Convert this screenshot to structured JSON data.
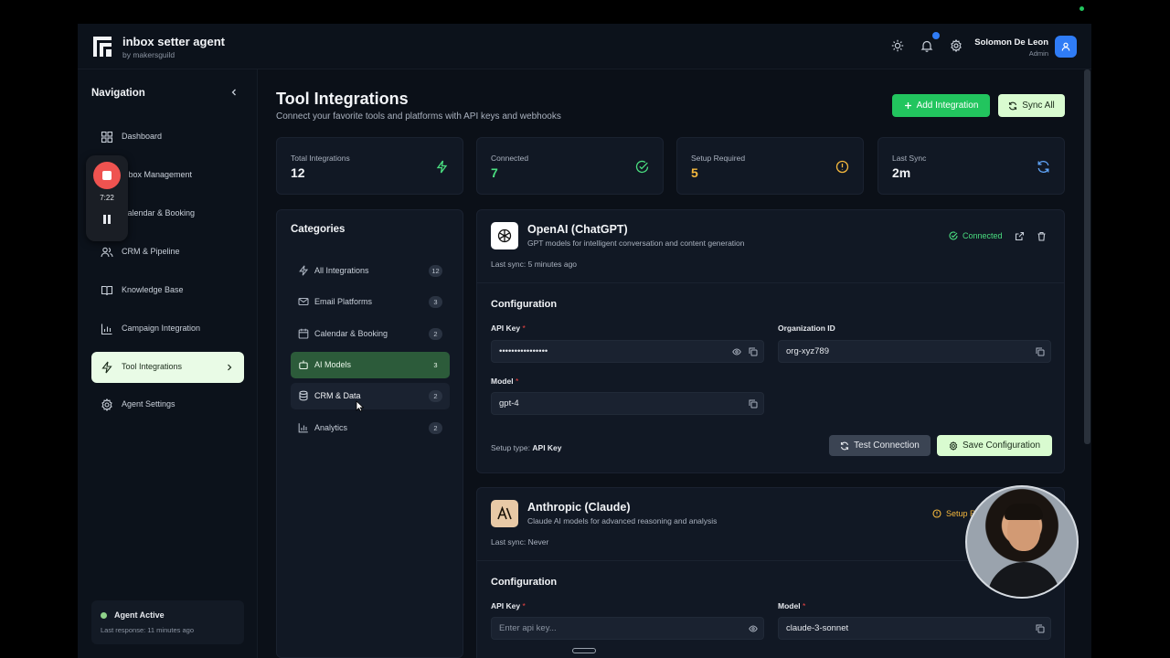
{
  "brand": {
    "title": "inbox setter agent",
    "subtitle": "by makersguild"
  },
  "header": {
    "user_name": "Solomon De Leon",
    "user_role": "Admin",
    "icons": [
      "sun-icon",
      "bell-icon",
      "gear-icon",
      "user-icon"
    ]
  },
  "recorder": {
    "time": "7:22"
  },
  "sidebar": {
    "title": "Navigation",
    "items": [
      {
        "label": "Dashboard",
        "icon": "grid-icon"
      },
      {
        "label": "Inbox Management",
        "icon": "inbox-icon"
      },
      {
        "label": "Calendar & Booking",
        "icon": "calendar-icon"
      },
      {
        "label": "CRM & Pipeline",
        "icon": "users-icon"
      },
      {
        "label": "Knowledge Base",
        "icon": "book-icon"
      },
      {
        "label": "Campaign Integration",
        "icon": "chart-icon"
      },
      {
        "label": "Tool Integrations",
        "icon": "bolt-icon",
        "active": true
      },
      {
        "label": "Agent Settings",
        "icon": "gear-icon"
      }
    ],
    "status": {
      "title": "Agent Active",
      "subtitle": "Last response: 11 minutes ago"
    }
  },
  "page": {
    "title": "Tool Integrations",
    "subtitle": "Connect your favorite tools and platforms with API keys and webhooks",
    "add_label": "Add Integration",
    "sync_label": "Sync All"
  },
  "stats": [
    {
      "label": "Total Integrations",
      "value": "12",
      "color": "#f2f4f7",
      "icon": "bolt-icon"
    },
    {
      "label": "Connected",
      "value": "7",
      "color": "#4ade80",
      "icon": "check-circle-icon"
    },
    {
      "label": "Setup Required",
      "value": "5",
      "color": "#f5b83d",
      "icon": "alert-circle-icon"
    },
    {
      "label": "Last Sync",
      "value": "2m",
      "color": "#f2f4f7",
      "icon": "refresh-icon"
    }
  ],
  "categories": {
    "title": "Categories",
    "items": [
      {
        "label": "All Integrations",
        "count": "12"
      },
      {
        "label": "Email Platforms",
        "count": "3"
      },
      {
        "label": "Calendar & Booking",
        "count": "2"
      },
      {
        "label": "AI Models",
        "count": "3",
        "active": true
      },
      {
        "label": "CRM & Data",
        "count": "2"
      },
      {
        "label": "Analytics",
        "count": "2"
      }
    ]
  },
  "integrations": [
    {
      "name": "OpenAI (ChatGPT)",
      "description": "GPT models for intelligent conversation and content generation",
      "last_sync": "Last sync: 5 minutes ago",
      "status": "Connected",
      "config_title": "Configuration",
      "api_key_label": "API Key",
      "api_key_value": "••••••••••••••••",
      "org_label": "Organization ID",
      "org_value": "org-xyz789",
      "model_label": "Model",
      "model_value": "gpt-4",
      "setup_type_label": "Setup type:",
      "setup_type_value": "API Key",
      "test_label": "Test Connection",
      "save_label": "Save Configuration"
    },
    {
      "name": "Anthropic (Claude)",
      "description": "Claude AI models for advanced reasoning and analysis",
      "last_sync": "Last sync: Never",
      "status": "Setup R",
      "config_title": "Configuration",
      "api_key_label": "API Key",
      "api_key_placeholder": "Enter api key...",
      "model_label": "Model",
      "model_value": "claude-3-sonnet"
    }
  ],
  "colors": {
    "accent_green": "#22c55e",
    "active_bg": "#e9fbe6",
    "warning": "#f5b83d",
    "blue": "#2f7cf6"
  }
}
